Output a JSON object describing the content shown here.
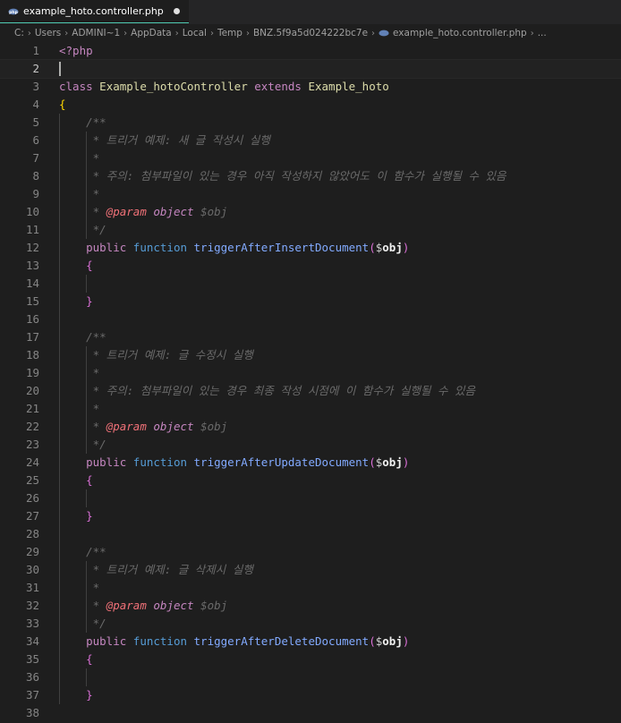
{
  "tab": {
    "filename": "example_hoto.controller.php",
    "icon": "php-elephant-icon"
  },
  "breadcrumb": [
    "C:",
    "Users",
    "ADMINI~1",
    "AppData",
    "Local",
    "Temp",
    "BNZ.5f9a5d024222bc7e",
    "example_hoto.controller.php",
    "..."
  ],
  "colors": {
    "accent": "#4ec9b0",
    "background": "#1e1e1e"
  },
  "lines": [
    {
      "n": "1",
      "tokens": [
        [
          "t-php",
          "<?php"
        ]
      ]
    },
    {
      "n": "2",
      "tokens": [],
      "current": true
    },
    {
      "n": "3",
      "tokens": [
        [
          "t-kw",
          "class"
        ],
        [
          "",
          ""
        ],
        [
          "t-cls",
          " Example_hotoController"
        ],
        [
          "t-kw",
          " extends"
        ],
        [
          "t-cls",
          " Example_hoto"
        ]
      ]
    },
    {
      "n": "4",
      "tokens": [
        [
          "t-brace",
          "{"
        ]
      ]
    },
    {
      "n": "5",
      "tokens": [
        [
          "",
          "    "
        ],
        [
          "t-com",
          "/**"
        ]
      ]
    },
    {
      "n": "6",
      "tokens": [
        [
          "",
          "     "
        ],
        [
          "t-com",
          "* 트리거 예제: 새 글 작성시 실행"
        ]
      ]
    },
    {
      "n": "7",
      "tokens": [
        [
          "",
          "     "
        ],
        [
          "t-com",
          "*"
        ]
      ]
    },
    {
      "n": "8",
      "tokens": [
        [
          "",
          "     "
        ],
        [
          "t-com",
          "* 주의: 첨부파일이 있는 경우 아직 작성하지 않았어도 이 함수가 실행될 수 있음"
        ]
      ]
    },
    {
      "n": "9",
      "tokens": [
        [
          "",
          "     "
        ],
        [
          "t-com",
          "*"
        ]
      ]
    },
    {
      "n": "10",
      "tokens": [
        [
          "",
          "     "
        ],
        [
          "t-com",
          "* "
        ],
        [
          "t-doc",
          "@param"
        ],
        [
          "t-type",
          " object"
        ],
        [
          "t-com",
          " $obj"
        ]
      ]
    },
    {
      "n": "11",
      "tokens": [
        [
          "",
          "     "
        ],
        [
          "t-com",
          "*/"
        ]
      ]
    },
    {
      "n": "12",
      "tokens": [
        [
          "",
          "    "
        ],
        [
          "t-pub",
          "public"
        ],
        [
          "t-func",
          " function"
        ],
        [
          "t-fn",
          " triggerAfterInsertDocument"
        ],
        [
          "t-paren",
          "("
        ],
        [
          "t-dollar",
          "$"
        ],
        [
          "t-var",
          "obj"
        ],
        [
          "t-paren",
          ")"
        ]
      ]
    },
    {
      "n": "13",
      "tokens": [
        [
          "",
          "    "
        ],
        [
          "t-brace2",
          "{"
        ]
      ]
    },
    {
      "n": "14",
      "tokens": []
    },
    {
      "n": "15",
      "tokens": [
        [
          "",
          "    "
        ],
        [
          "t-brace2",
          "}"
        ]
      ]
    },
    {
      "n": "16",
      "tokens": []
    },
    {
      "n": "17",
      "tokens": [
        [
          "",
          "    "
        ],
        [
          "t-com",
          "/**"
        ]
      ]
    },
    {
      "n": "18",
      "tokens": [
        [
          "",
          "     "
        ],
        [
          "t-com",
          "* 트리거 예제: 글 수정시 실행"
        ]
      ]
    },
    {
      "n": "19",
      "tokens": [
        [
          "",
          "     "
        ],
        [
          "t-com",
          "*"
        ]
      ]
    },
    {
      "n": "20",
      "tokens": [
        [
          "",
          "     "
        ],
        [
          "t-com",
          "* 주의: 첨부파일이 있는 경우 최종 작성 시점에 이 함수가 실행될 수 있음"
        ]
      ]
    },
    {
      "n": "21",
      "tokens": [
        [
          "",
          "     "
        ],
        [
          "t-com",
          "*"
        ]
      ]
    },
    {
      "n": "22",
      "tokens": [
        [
          "",
          "     "
        ],
        [
          "t-com",
          "* "
        ],
        [
          "t-doc",
          "@param"
        ],
        [
          "t-type",
          " object"
        ],
        [
          "t-com",
          " $obj"
        ]
      ]
    },
    {
      "n": "23",
      "tokens": [
        [
          "",
          "     "
        ],
        [
          "t-com",
          "*/"
        ]
      ]
    },
    {
      "n": "24",
      "tokens": [
        [
          "",
          "    "
        ],
        [
          "t-pub",
          "public"
        ],
        [
          "t-func",
          " function"
        ],
        [
          "t-fn",
          " triggerAfterUpdateDocument"
        ],
        [
          "t-paren",
          "("
        ],
        [
          "t-dollar",
          "$"
        ],
        [
          "t-var",
          "obj"
        ],
        [
          "t-paren",
          ")"
        ]
      ]
    },
    {
      "n": "25",
      "tokens": [
        [
          "",
          "    "
        ],
        [
          "t-brace2",
          "{"
        ]
      ]
    },
    {
      "n": "26",
      "tokens": []
    },
    {
      "n": "27",
      "tokens": [
        [
          "",
          "    "
        ],
        [
          "t-brace2",
          "}"
        ]
      ]
    },
    {
      "n": "28",
      "tokens": []
    },
    {
      "n": "29",
      "tokens": [
        [
          "",
          "    "
        ],
        [
          "t-com",
          "/**"
        ]
      ]
    },
    {
      "n": "30",
      "tokens": [
        [
          "",
          "     "
        ],
        [
          "t-com",
          "* 트리거 예제: 글 삭제시 실행"
        ]
      ]
    },
    {
      "n": "31",
      "tokens": [
        [
          "",
          "     "
        ],
        [
          "t-com",
          "*"
        ]
      ]
    },
    {
      "n": "32",
      "tokens": [
        [
          "",
          "     "
        ],
        [
          "t-com",
          "* "
        ],
        [
          "t-doc",
          "@param"
        ],
        [
          "t-type",
          " object"
        ],
        [
          "t-com",
          " $obj"
        ]
      ]
    },
    {
      "n": "33",
      "tokens": [
        [
          "",
          "     "
        ],
        [
          "t-com",
          "*/"
        ]
      ]
    },
    {
      "n": "34",
      "tokens": [
        [
          "",
          "    "
        ],
        [
          "t-pub",
          "public"
        ],
        [
          "t-func",
          " function"
        ],
        [
          "t-fn",
          " triggerAfterDeleteDocument"
        ],
        [
          "t-paren",
          "("
        ],
        [
          "t-dollar",
          "$"
        ],
        [
          "t-var",
          "obj"
        ],
        [
          "t-paren",
          ")"
        ]
      ]
    },
    {
      "n": "35",
      "tokens": [
        [
          "",
          "    "
        ],
        [
          "t-brace2",
          "{"
        ]
      ]
    },
    {
      "n": "36",
      "tokens": []
    },
    {
      "n": "37",
      "tokens": [
        [
          "",
          "    "
        ],
        [
          "t-brace2",
          "}"
        ]
      ]
    },
    {
      "n": "38",
      "tokens": []
    }
  ]
}
